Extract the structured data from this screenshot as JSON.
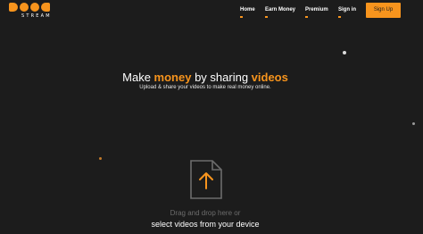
{
  "logo": {
    "subtitle": "STREAM"
  },
  "nav": {
    "home": "Home",
    "earn": "Earn Money",
    "premium": "Premium",
    "signin": "Sign in",
    "signup": "Sign Up"
  },
  "hero": {
    "title_part1": "Make ",
    "title_highlight1": "money",
    "title_part2": " by sharing ",
    "title_highlight2": "videos",
    "subtitle": "Upload & share your videos to make real money online."
  },
  "upload": {
    "drag_text": "Drag and drop here or",
    "select_text": "select videos from your device"
  },
  "colors": {
    "accent": "#f7941d",
    "background": "#1c1c1c"
  },
  "icons": {
    "upload": "upload-arrow-icon",
    "logo": "doodstream-logo"
  }
}
